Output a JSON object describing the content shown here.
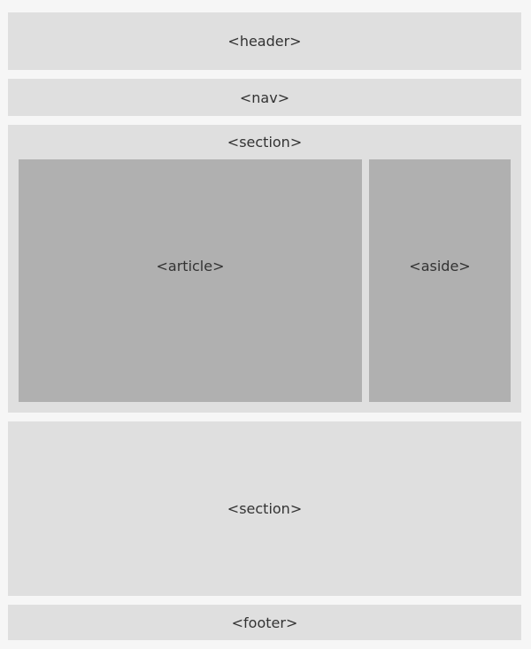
{
  "header": {
    "label": "<header>"
  },
  "nav": {
    "label": "<nav>"
  },
  "section_top": {
    "label": "<section>",
    "article": {
      "label": "<article>"
    },
    "aside": {
      "label": "<aside>"
    }
  },
  "section_bottom": {
    "label": "<section>"
  },
  "footer": {
    "label": "<footer>"
  }
}
